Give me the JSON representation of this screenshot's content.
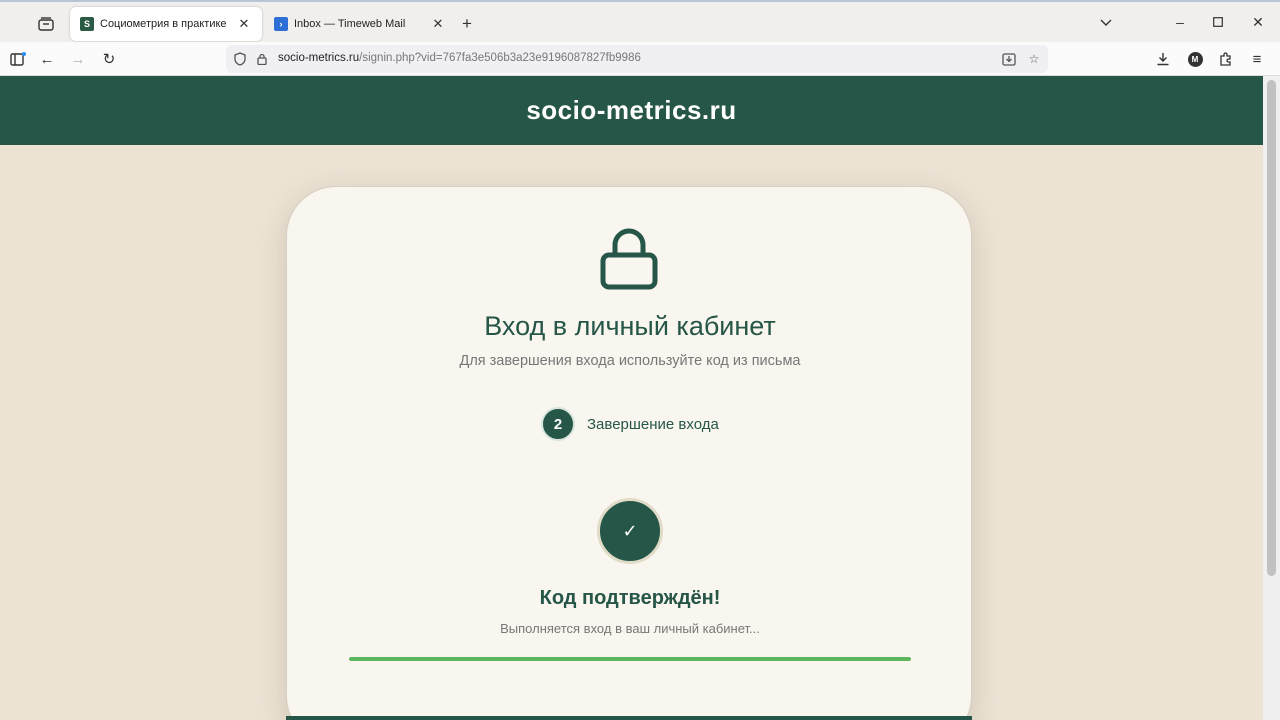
{
  "browser": {
    "tabs": [
      {
        "favicon": "S",
        "title": "Социометрия в практике",
        "active": true
      },
      {
        "favicon": "›",
        "title": "Inbox — Timeweb Mail",
        "active": false
      }
    ],
    "url": {
      "host": "socio-metrics.ru",
      "path": "/signin.php?vid=767fa3e506b3a23e9196087827fb9986"
    },
    "account_initial": "M"
  },
  "site": {
    "title": "socio-metrics.ru"
  },
  "card": {
    "title": "Вход в личный кабинет",
    "subtitle": "Для завершения входа используйте код из письма",
    "step_number": "2",
    "step_label": "Завершение входа",
    "check_symbol": "✓",
    "success_title": "Код подтверждён!",
    "success_subtitle": "Выполняется вход в ваш личный кабинет...",
    "progress": 1.0
  },
  "colors": {
    "brand": "#265647",
    "page_bg": "#ece3d5",
    "card_bg": "#f9f6f0",
    "progress": "#5cb65c"
  }
}
